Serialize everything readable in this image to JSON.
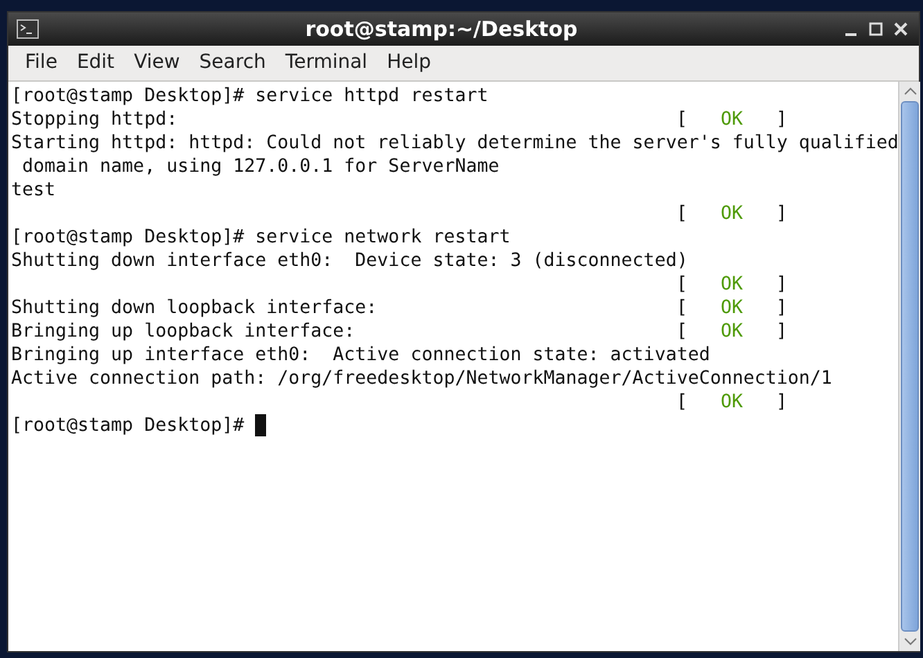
{
  "window": {
    "title": "root@stamp:~/Desktop"
  },
  "menu": [
    "File",
    "Edit",
    "View",
    "Search",
    "Terminal",
    "Help"
  ],
  "terminal": {
    "lines": [
      {
        "text": "[root@stamp Desktop]# service httpd restart"
      },
      {
        "text": "Stopping httpd:",
        "result": {
          "open": "[",
          "word": "OK",
          "close": "]"
        }
      },
      {
        "text": "Starting httpd: httpd: Could not reliably determine the server's fully qualified"
      },
      {
        "text": " domain name, using 127.0.0.1 for ServerName"
      },
      {
        "text": "test"
      },
      {
        "result": {
          "open": "[",
          "word": "OK",
          "close": "]"
        }
      },
      {
        "text": "[root@stamp Desktop]# service network restart"
      },
      {
        "text": "Shutting down interface eth0:  Device state: 3 (disconnected)"
      },
      {
        "result": {
          "open": "[",
          "word": "OK",
          "close": "]"
        }
      },
      {
        "text": "Shutting down loopback interface:",
        "result": {
          "open": "[",
          "word": "OK",
          "close": "]"
        }
      },
      {
        "text": "Bringing up loopback interface:",
        "result": {
          "open": "[",
          "word": "OK",
          "close": "]"
        }
      },
      {
        "text": "Bringing up interface eth0:  Active connection state: activated"
      },
      {
        "text": "Active connection path: /org/freedesktop/NetworkManager/ActiveConnection/1"
      },
      {
        "result": {
          "open": "[",
          "word": "OK",
          "close": "]"
        }
      },
      {
        "text": "[root@stamp Desktop]# ",
        "cursor": true
      }
    ]
  }
}
